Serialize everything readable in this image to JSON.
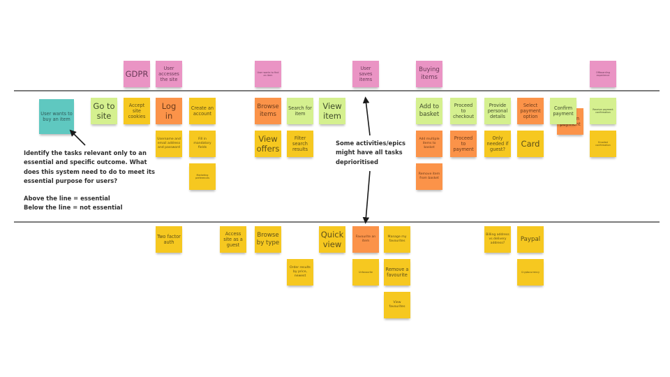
{
  "board": {
    "background": "#ffffff",
    "line_color": "#7a7a7a"
  },
  "colors": {
    "pink": "#ea94c4",
    "green": "#d5f08f",
    "orange": "#fb9349",
    "yellow": "#f7d23b",
    "teal": "#5fc8c0"
  },
  "goal_note": {
    "text": "User wants to buy an item"
  },
  "activities": [
    {
      "text": "GDPR"
    },
    {
      "text": "User accesses the site"
    },
    {
      "text": "User wants to find an item"
    },
    {
      "text": "User saves items"
    },
    {
      "text": "Buying items"
    },
    {
      "text": "Offboarding experience"
    }
  ],
  "essential_tasks": [
    {
      "text": "Go to site"
    },
    {
      "text": "Accept site cookies"
    },
    {
      "text": "Log in"
    },
    {
      "text": "Username and email address and password"
    },
    {
      "text": "Create an account"
    },
    {
      "text": "Fill in mandatory fields"
    },
    {
      "text": "Marketing preferences"
    },
    {
      "text": "Browse items"
    },
    {
      "text": "View offers"
    },
    {
      "text": "Search for item"
    },
    {
      "text": "Filter search results"
    },
    {
      "text": "View item"
    },
    {
      "text": "Add to basket"
    },
    {
      "text": "Add multiple items to basket"
    },
    {
      "text": "Remove item from basket"
    },
    {
      "text": "Proceed to checkout"
    },
    {
      "text": "Proceed to payment"
    },
    {
      "text": "Provide personal details"
    },
    {
      "text": "Only needed if guest?"
    },
    {
      "text": "Select payment option"
    },
    {
      "text": "Card"
    },
    {
      "text": "Confirm payment"
    },
    {
      "text": "Confirm payment"
    },
    {
      "text": "Receive payment confirmation"
    },
    {
      "text": "Emailed confirmation"
    }
  ],
  "non_essential_tasks": [
    {
      "text": "Two factor auth"
    },
    {
      "text": "Access site as a guest"
    },
    {
      "text": "Browse by type"
    },
    {
      "text": "Order results by price, newest"
    },
    {
      "text": "Quick view"
    },
    {
      "text": "Favourite an item"
    },
    {
      "text": "Unfavourite"
    },
    {
      "text": "Manage my favourites"
    },
    {
      "text": "Remove a favourite"
    },
    {
      "text": "View favourites"
    },
    {
      "text": "Billing address vs delivery address?"
    },
    {
      "text": "Paypal"
    },
    {
      "text": "Cryptocurrency"
    }
  ],
  "annotations": {
    "instructions_lines": [
      "Identify the tasks relevant only to an",
      "essential and specific outcome. What",
      "does this system need to do to meet its",
      "essential purpose for users?",
      "",
      "Above the line = essential",
      "Below the line = not essential"
    ],
    "deprioritised_lines": [
      "Some activities/epics",
      "might have all tasks",
      "deprioritised"
    ]
  }
}
